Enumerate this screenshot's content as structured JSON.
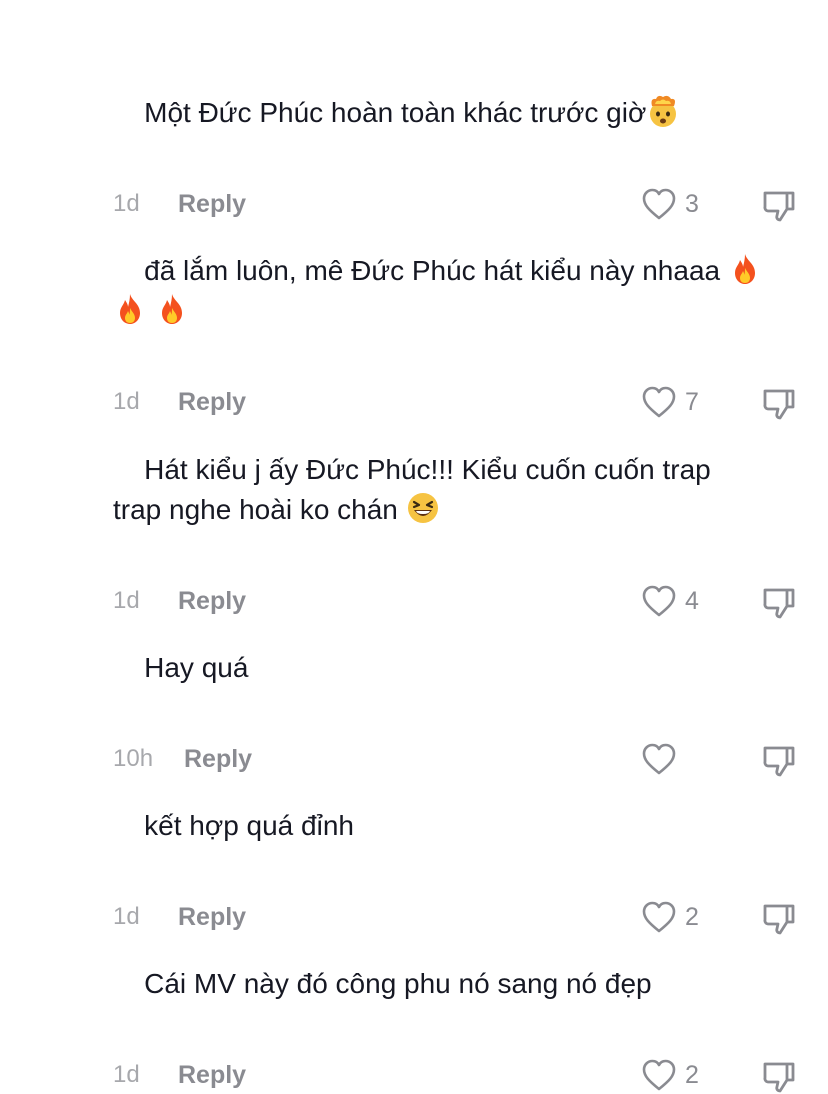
{
  "comments": [
    {
      "text": "Một Đức Phúc hoàn toàn khác trước giờ",
      "emoji": "exploding-head-emoji",
      "time": "1d",
      "reply_label": "Reply",
      "likes": "3"
    },
    {
      "text": "đã lắm luôn, mê Đức Phúc hát kiểu này nhaaa",
      "emoji": "fire-emoji",
      "time": "1d",
      "reply_label": "Reply",
      "likes": "7"
    },
    {
      "text_line1": "Hát kiểu j ấy Đức Phúc!!! Kiểu cuốn cuốn trap",
      "text_line2": "trap nghe hoài ko chán",
      "emoji": "grinning-squinting-face-emoji",
      "time": "1d",
      "reply_label": "Reply",
      "likes": "4"
    },
    {
      "text": "Hay quá",
      "time": "10h",
      "reply_label": "Reply",
      "likes": ""
    },
    {
      "text": "kết hợp quá đỉnh",
      "time": "1d",
      "reply_label": "Reply",
      "likes": "2"
    },
    {
      "text": "Cái MV này đó công phu nó sang nó đẹp",
      "time": "1d",
      "reply_label": "Reply",
      "likes": "2"
    }
  ],
  "colors": {
    "text": "#161823",
    "muted": "#8a8b91",
    "time": "#a7a8ac",
    "icon": "#8a8b91"
  }
}
